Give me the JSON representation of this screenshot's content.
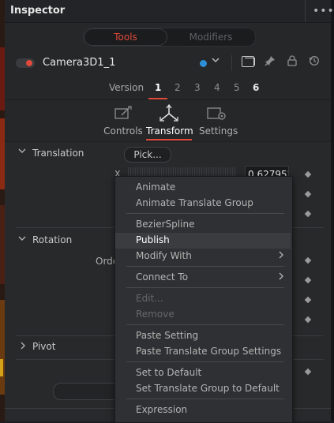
{
  "header": {
    "title": "Inspector",
    "more_icon": "more-horizontal-icon"
  },
  "mode_tabs": {
    "tools": "Tools",
    "modifiers": "Modifiers",
    "active": "Tools"
  },
  "node": {
    "name": "Camera3D1_1",
    "color": "#2d8fd6"
  },
  "version": {
    "label": "Version",
    "items": [
      "1",
      "2",
      "3",
      "4",
      "5",
      "6"
    ],
    "active": "1"
  },
  "subtabs": [
    {
      "label": "Controls"
    },
    {
      "label": "Transform"
    },
    {
      "label": "Settings"
    }
  ],
  "sections": {
    "translation": {
      "title": "Translation",
      "pick_label": "Pick...",
      "x_label": "X",
      "x_value": "0.627952"
    },
    "rotation": {
      "title": "Rotation",
      "order_label": "Orde"
    },
    "pivot": {
      "title": "Pivot"
    }
  },
  "context_menu": {
    "groups": [
      [
        {
          "label": "Animate",
          "enabled": true
        },
        {
          "label": "Animate Translate Group",
          "enabled": true
        }
      ],
      [
        {
          "label": "BezierSpline",
          "enabled": true
        },
        {
          "label": "Publish",
          "enabled": true,
          "highlighted": true
        },
        {
          "label": "Modify With",
          "enabled": true,
          "submenu": true
        }
      ],
      [
        {
          "label": "Connect To",
          "enabled": true,
          "submenu": true
        }
      ],
      [
        {
          "label": "Edit...",
          "enabled": false
        },
        {
          "label": "Remove",
          "enabled": false
        }
      ],
      [
        {
          "label": "Paste Setting",
          "enabled": true
        },
        {
          "label": "Paste Translate Group Settings",
          "enabled": true
        }
      ],
      [
        {
          "label": "Set to Default",
          "enabled": true
        },
        {
          "label": "Set Translate Group to Default",
          "enabled": true
        }
      ],
      [
        {
          "label": "Expression",
          "enabled": true
        }
      ]
    ]
  },
  "colors": {
    "accent": "#e0493b",
    "panel": "#262729",
    "menu": "#2f3033"
  }
}
